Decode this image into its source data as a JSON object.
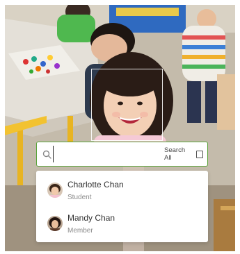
{
  "search": {
    "value": "",
    "search_all_label": "Search All",
    "accent_color": "#5aa33a"
  },
  "results": [
    {
      "name": "Charlotte Chan",
      "role": "Student",
      "avatar_icon": "avatar-charlotte"
    },
    {
      "name": "Mandy Chan",
      "role": "Member",
      "avatar_icon": "avatar-mandy"
    }
  ]
}
